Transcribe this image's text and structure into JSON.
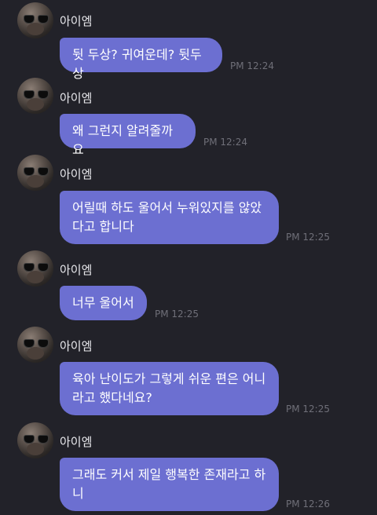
{
  "messages": [
    {
      "sender": "아이엠",
      "text": "뒷 두상? 귀여운데? 뒷두상",
      "time": "PM 12:24"
    },
    {
      "sender": "아이엠",
      "text": "왜 그런지 알려줄까요",
      "time": "PM 12:24"
    },
    {
      "sender": "아이엠",
      "text_lines": [
        "어릴때 하도 울어서 누워있지를 않았",
        "다고 합니다"
      ],
      "time": "PM 12:25"
    },
    {
      "sender": "아이엠",
      "text": "너무 울어서",
      "time": "PM 12:25"
    },
    {
      "sender": "아이엠",
      "text_lines": [
        "육아 난이도가 그렇게 쉬운 편은 어니",
        "라고 했다네요?"
      ],
      "time": "PM 12:25"
    },
    {
      "sender": "아이엠",
      "text_lines": [
        "그래도 커서 제일 행복한 존재라고 하",
        "니"
      ],
      "time": "PM 12:26"
    }
  ],
  "colors": {
    "background": "#222229",
    "bubble": "#6c6fd1",
    "timestamp": "#6f6f78",
    "sender_name": "#e8e8ec"
  },
  "icons": [
    "avatar-image"
  ]
}
